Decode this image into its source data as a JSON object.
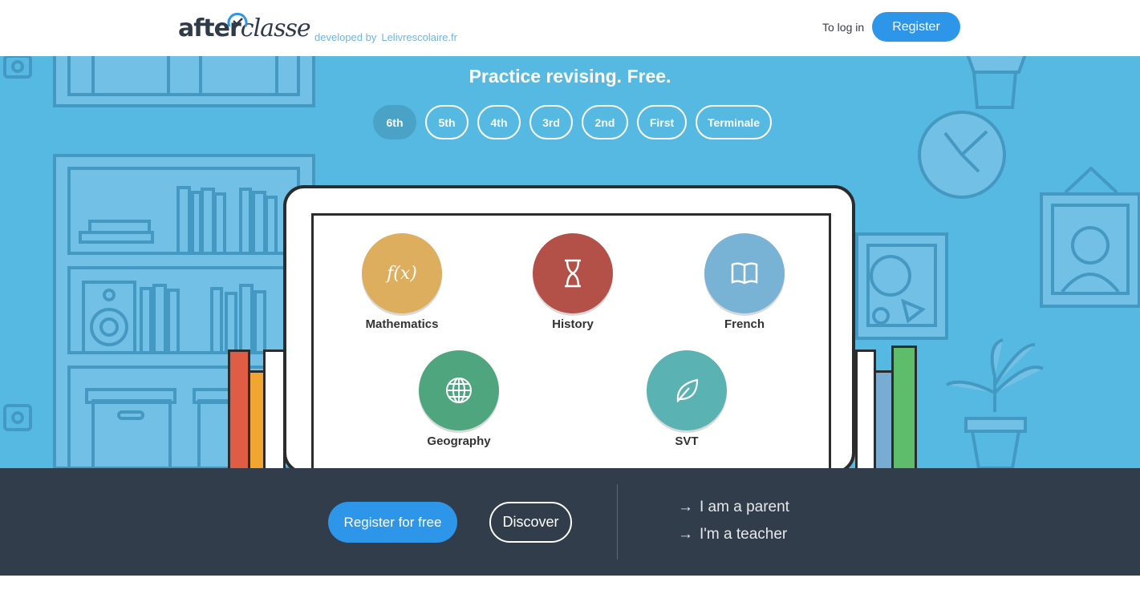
{
  "header": {
    "logo_first": "after",
    "logo_second": "classe",
    "developed_by": "developed by",
    "developer_site": "Lelivrescolaire.fr",
    "login_label": "To log in",
    "register_label": "Register"
  },
  "hero": {
    "title": "Practice revising. Free.",
    "levels": [
      {
        "label": "6th",
        "active": true
      },
      {
        "label": "5th",
        "active": false
      },
      {
        "label": "4th",
        "active": false
      },
      {
        "label": "3rd",
        "active": false
      },
      {
        "label": "2nd",
        "active": false
      },
      {
        "label": "First",
        "active": false
      },
      {
        "label": "Terminale",
        "active": false
      }
    ],
    "subjects": [
      {
        "label": "Mathematics",
        "icon": "function-icon",
        "color": "#dcae5e"
      },
      {
        "label": "History",
        "icon": "hourglass-icon",
        "color": "#b35149"
      },
      {
        "label": "French",
        "icon": "book-icon",
        "color": "#78b3d5"
      },
      {
        "label": "Geography",
        "icon": "globe-icon",
        "color": "#4fa57e"
      },
      {
        "label": "SVT",
        "icon": "leaf-icon",
        "color": "#5ab2b3"
      }
    ],
    "math_symbol": "f(x)"
  },
  "band": {
    "register_free": "Register for free",
    "discover": "Discover",
    "links": [
      "I am a parent",
      "I'm a teacher"
    ],
    "arrow": "→"
  },
  "colors": {
    "accent": "#2e96e8",
    "hero_bg": "#55b9e2",
    "band_bg": "#323d4b"
  }
}
